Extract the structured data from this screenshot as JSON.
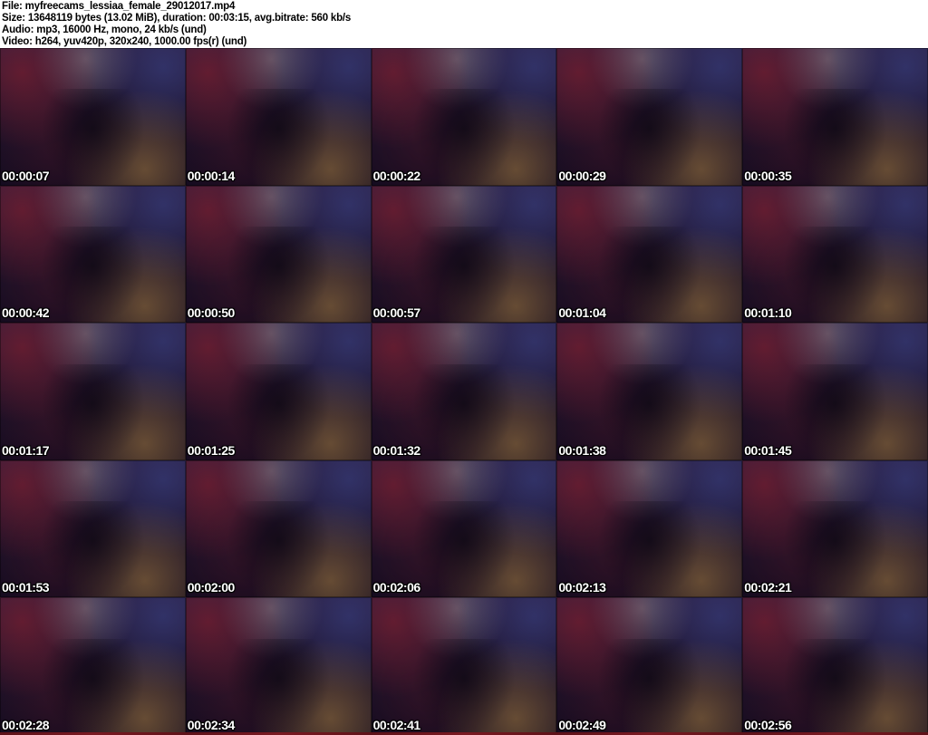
{
  "header": {
    "lines": [
      "File: myfreecams_lessiaa_female_29012017.mp4",
      "Size: 13648119 bytes (13.02 MiB), duration: 00:03:15, avg.bitrate: 560 kb/s",
      "Audio: mp3, 16000 Hz, mono, 24 kb/s (und)",
      "Video: h264, yuv420p, 320x240, 1000.00 fps(r) (und)"
    ]
  },
  "grid": {
    "rows": 5,
    "cols": 5,
    "thumbnails": [
      {
        "timestamp": "00:00:07"
      },
      {
        "timestamp": "00:00:14"
      },
      {
        "timestamp": "00:00:22"
      },
      {
        "timestamp": "00:00:29"
      },
      {
        "timestamp": "00:00:35"
      },
      {
        "timestamp": "00:00:42"
      },
      {
        "timestamp": "00:00:50"
      },
      {
        "timestamp": "00:00:57"
      },
      {
        "timestamp": "00:01:04"
      },
      {
        "timestamp": "00:01:10"
      },
      {
        "timestamp": "00:01:17"
      },
      {
        "timestamp": "00:01:25"
      },
      {
        "timestamp": "00:01:32"
      },
      {
        "timestamp": "00:01:38"
      },
      {
        "timestamp": "00:01:45"
      },
      {
        "timestamp": "00:01:53"
      },
      {
        "timestamp": "00:02:00"
      },
      {
        "timestamp": "00:02:06"
      },
      {
        "timestamp": "00:02:13"
      },
      {
        "timestamp": "00:02:21"
      },
      {
        "timestamp": "00:02:28"
      },
      {
        "timestamp": "00:02:34"
      },
      {
        "timestamp": "00:02:41"
      },
      {
        "timestamp": "00:02:49"
      },
      {
        "timestamp": "00:02:56"
      }
    ]
  },
  "colors": {
    "header_background": "#ffffff",
    "header_text": "#000000",
    "timestamp_text": "#ffffff",
    "timestamp_outline": "#000000",
    "tile_base_dark": "#1b1129",
    "tile_accent_red": "#94202c",
    "tile_accent_blue": "#3a468e",
    "tile_accent_tan": "#b68a46",
    "tile_accent_white": "#cdc6c0",
    "bottom_band_red": "#7a1a22"
  }
}
